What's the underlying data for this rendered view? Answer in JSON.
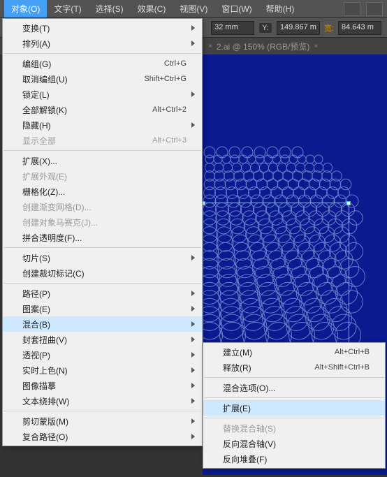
{
  "menubar": {
    "items": [
      "对象(O)",
      "文字(T)",
      "选择(S)",
      "效果(C)",
      "视图(V)",
      "窗口(W)",
      "帮助(H)"
    ]
  },
  "propbar": {
    "val1": "32 mm",
    "ylabel": "Y:",
    "val2": "149.867 m",
    "wlabel": "宽:",
    "val3": "84.643 m"
  },
  "tab": {
    "title": "2.ai @ 150% (RGB/预览)"
  },
  "menu1": [
    {
      "label": "变换(T)",
      "sub": true
    },
    {
      "label": "排列(A)",
      "sub": true
    },
    {
      "sep": true
    },
    {
      "label": "编组(G)",
      "sc": "Ctrl+G"
    },
    {
      "label": "取消编组(U)",
      "sc": "Shift+Ctrl+G"
    },
    {
      "label": "锁定(L)",
      "sub": true
    },
    {
      "label": "全部解锁(K)",
      "sc": "Alt+Ctrl+2"
    },
    {
      "label": "隐藏(H)",
      "sub": true
    },
    {
      "label": "显示全部",
      "sc": "Alt+Ctrl+3",
      "dis": true
    },
    {
      "sep": true
    },
    {
      "label": "扩展(X)..."
    },
    {
      "label": "扩展外观(E)",
      "dis": true
    },
    {
      "label": "栅格化(Z)..."
    },
    {
      "label": "创建渐变网格(D)...",
      "dis": true
    },
    {
      "label": "创建对象马赛克(J)...",
      "dis": true
    },
    {
      "label": "拼合透明度(F)..."
    },
    {
      "sep": true
    },
    {
      "label": "切片(S)",
      "sub": true
    },
    {
      "label": "创建裁切标记(C)"
    },
    {
      "sep": true
    },
    {
      "label": "路径(P)",
      "sub": true
    },
    {
      "label": "图案(E)",
      "sub": true
    },
    {
      "label": "混合(B)",
      "sub": true,
      "hl": true
    },
    {
      "label": "封套扭曲(V)",
      "sub": true
    },
    {
      "label": "透视(P)",
      "sub": true
    },
    {
      "label": "实时上色(N)",
      "sub": true
    },
    {
      "label": "图像描摹",
      "sub": true
    },
    {
      "label": "文本绕排(W)",
      "sub": true
    },
    {
      "sep": true
    },
    {
      "label": "剪切蒙版(M)",
      "sub": true
    },
    {
      "label": "复合路径(O)",
      "sub": true
    }
  ],
  "menu2": [
    {
      "label": "建立(M)",
      "sc": "Alt+Ctrl+B"
    },
    {
      "label": "释放(R)",
      "sc": "Alt+Shift+Ctrl+B"
    },
    {
      "sep": true
    },
    {
      "label": "混合选项(O)..."
    },
    {
      "sep": true
    },
    {
      "label": "扩展(E)",
      "hl": true
    },
    {
      "sep": true
    },
    {
      "label": "替换混合轴(S)",
      "dis": true
    },
    {
      "label": "反向混合轴(V)"
    },
    {
      "label": "反向堆叠(F)"
    }
  ]
}
